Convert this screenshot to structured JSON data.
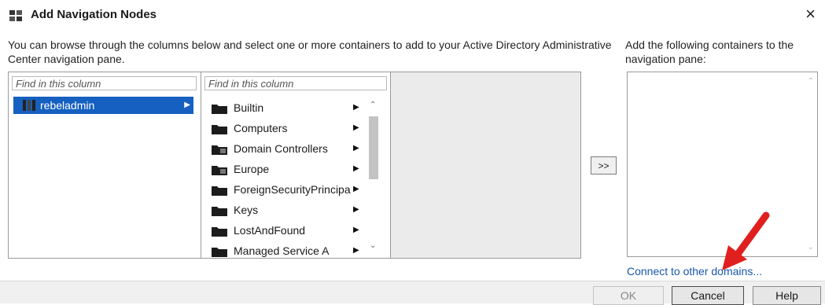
{
  "window": {
    "title": "Add Navigation Nodes",
    "close_glyph": "×"
  },
  "instructions": {
    "left": "You can browse through the columns below and select one or more containers to add to your Active Directory Administrative Center navigation pane.",
    "right": "Add the following containers to the navigation pane:"
  },
  "columns": {
    "col1": {
      "placeholder": "Find in this column",
      "selected_node": "rebeladmin"
    },
    "col2": {
      "placeholder": "Find in this column",
      "items": [
        {
          "label": "Builtin"
        },
        {
          "label": "Computers"
        },
        {
          "label": "Domain Controllers"
        },
        {
          "label": "Europe"
        },
        {
          "label": "ForeignSecurityPrincipa"
        },
        {
          "label": "Keys"
        },
        {
          "label": "LostAndFound"
        },
        {
          "label": "Managed Service A"
        }
      ]
    }
  },
  "add_button": ">>",
  "connect_link": "Connect to other domains...",
  "footer": {
    "ok": "OK",
    "cancel": "Cancel",
    "help": "Help"
  },
  "colors": {
    "selection": "#1560c0",
    "link": "#1a55b0",
    "annotation_arrow": "#e0201e"
  }
}
